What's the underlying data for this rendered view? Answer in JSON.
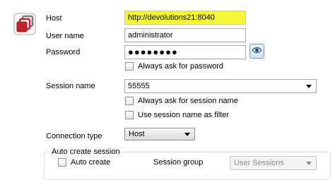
{
  "form": {
    "host": {
      "label": "Host",
      "value": "http://devolutions21:8040"
    },
    "username": {
      "label": "User name",
      "value": "administrator"
    },
    "password": {
      "label": "Password",
      "value": "●●●●●●●●",
      "show_password_icon": "eye-icon"
    },
    "always_ask_password": {
      "label": "Always ask for password",
      "checked": false
    },
    "session_name": {
      "label": "Session name",
      "value": "55555"
    },
    "always_ask_session_name": {
      "label": "Always ask for session name",
      "checked": false
    },
    "use_session_name_filter": {
      "label": "Use session name as filter",
      "checked": false
    },
    "connection_type": {
      "label": "Connection type",
      "value": "Host"
    },
    "auto_create_session": {
      "group_title": "Auto create session",
      "auto_create": {
        "label": "Auto create",
        "checked": false
      },
      "session_group": {
        "label": "Session group",
        "value": "User Sessions"
      }
    }
  },
  "colors": {
    "highlight": "#f7f73a",
    "accent": "#c0272d",
    "logo_gray": "#7a7a7a"
  },
  "icons": {
    "logo": "devolutions-logo-icon"
  }
}
